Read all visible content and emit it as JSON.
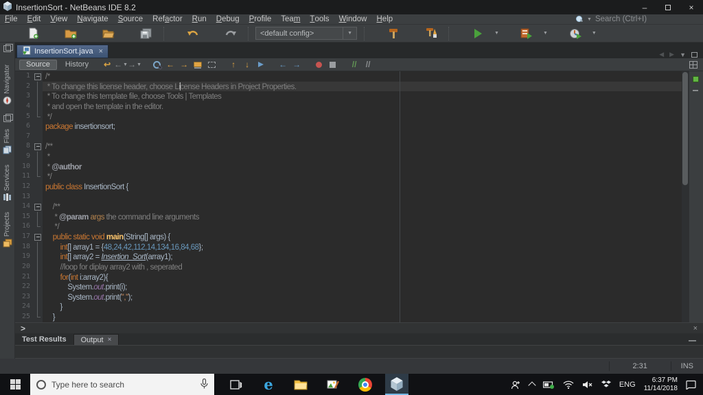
{
  "window": {
    "title": "InsertionSort - NetBeans IDE 8.2"
  },
  "menubar": {
    "items": [
      {
        "label": "File",
        "mn": 0
      },
      {
        "label": "Edit",
        "mn": 0
      },
      {
        "label": "View",
        "mn": 0
      },
      {
        "label": "Navigate",
        "mn": 0
      },
      {
        "label": "Source",
        "mn": 0
      },
      {
        "label": "Refactor",
        "mn": 3
      },
      {
        "label": "Run",
        "mn": 0
      },
      {
        "label": "Debug",
        "mn": 0
      },
      {
        "label": "Profile",
        "mn": 0
      },
      {
        "label": "Team",
        "mn": 3
      },
      {
        "label": "Tools",
        "mn": 0
      },
      {
        "label": "Window",
        "mn": 0
      },
      {
        "label": "Help",
        "mn": 0
      }
    ],
    "search_placeholder": "Search (Ctrl+I)"
  },
  "toolbar": {
    "config_value": "<default config>"
  },
  "sidebar": {
    "items": [
      {
        "label": "Navigator",
        "icon": "compass-icon"
      },
      {
        "label": "Files",
        "icon": "files-icon"
      },
      {
        "label": "Services",
        "icon": "services-icon"
      },
      {
        "label": "Projects",
        "icon": "projects-icon"
      }
    ]
  },
  "editor": {
    "tab_title": "InsertionSort.java",
    "view_source": "Source",
    "view_history": "History",
    "breadcrumb_chevron": ">",
    "close_glyph": "×",
    "minimize_glyph": "—",
    "caret_status": "2:31",
    "toolbar_icons": [
      {
        "name": "last-edit-position-icon",
        "glyph": "↩",
        "color": "#d9a343"
      },
      {
        "name": "back-icon",
        "glyph": "←",
        "color": "#8a8d8f",
        "dd": true
      },
      {
        "name": "forward-icon",
        "glyph": "→",
        "color": "#8a8d8f",
        "dd": true
      },
      {
        "name": "sep"
      },
      {
        "name": "find-selection-icon",
        "shape": "mag"
      },
      {
        "name": "previous-occurrence-icon",
        "glyph": "←",
        "color": "#e0a343"
      },
      {
        "name": "next-occurrence-icon",
        "glyph": "→",
        "color": "#e0a343"
      },
      {
        "name": "toggle-highlight-icon",
        "shape": "block"
      },
      {
        "name": "rectangular-selection-icon",
        "shape": "dashedrect"
      },
      {
        "name": "sep"
      },
      {
        "name": "move-up-icon",
        "glyph": "↑",
        "color": "#e0a343"
      },
      {
        "name": "move-down-icon",
        "glyph": "↓",
        "color": "#e0a343"
      },
      {
        "name": "next-bookmark-icon",
        "shape": "flag"
      },
      {
        "name": "sep"
      },
      {
        "name": "shift-left-icon",
        "glyph": "←",
        "color": "#6a9cc8"
      },
      {
        "name": "shift-right-icon",
        "glyph": "→",
        "color": "#6a9cc8"
      },
      {
        "name": "sep"
      },
      {
        "name": "record-macro-icon",
        "shape": "dot"
      },
      {
        "name": "stop-macro-icon",
        "shape": "square"
      },
      {
        "name": "sep"
      },
      {
        "name": "comment-icon",
        "glyph": "//",
        "color": "#629755"
      },
      {
        "name": "uncomment-icon",
        "glyph": "//",
        "color": "#8a8d8f"
      }
    ],
    "lines": [
      {
        "fold": "start",
        "segs": [
          [
            "/*",
            "sc"
          ]
        ]
      },
      {
        "fold": "mid",
        "hl": true,
        "segs": [
          [
            " * To change this license header, choose License Headers in Project Properties.",
            "sc"
          ]
        ]
      },
      {
        "fold": "mid",
        "segs": [
          [
            " * To change this template file, choose Tools | Templates",
            "sc"
          ]
        ]
      },
      {
        "fold": "mid",
        "segs": [
          [
            " * and open the template in the editor.",
            "sc"
          ]
        ]
      },
      {
        "fold": "end",
        "segs": [
          [
            " */",
            "sc"
          ]
        ]
      },
      {
        "fold": "",
        "segs": [
          [
            "package",
            "sk"
          ],
          [
            " insertionsort;",
            "sd"
          ]
        ]
      },
      {
        "fold": "",
        "segs": []
      },
      {
        "fold": "start",
        "segs": [
          [
            "/**",
            "sc"
          ]
        ]
      },
      {
        "fold": "mid",
        "segs": [
          [
            " *",
            "sc"
          ]
        ]
      },
      {
        "fold": "mid",
        "segs": [
          [
            " * ",
            "sc"
          ],
          [
            "@author",
            "st"
          ]
        ]
      },
      {
        "fold": "end",
        "segs": [
          [
            " */",
            "sc"
          ]
        ]
      },
      {
        "fold": "",
        "segs": [
          [
            "public ",
            "sk"
          ],
          [
            "class ",
            "sk"
          ],
          [
            "InsertionSort {",
            "sd"
          ]
        ]
      },
      {
        "fold": "",
        "segs": []
      },
      {
        "fold": "start",
        "segs": [
          [
            "    /**",
            "sc"
          ]
        ]
      },
      {
        "fold": "mid",
        "segs": [
          [
            "     * ",
            "sc"
          ],
          [
            "@param",
            "st"
          ],
          [
            " ",
            "sc"
          ],
          [
            "args",
            "sp"
          ],
          [
            " the command line arguments",
            "sc"
          ]
        ]
      },
      {
        "fold": "end",
        "segs": [
          [
            "     */",
            "sc"
          ]
        ]
      },
      {
        "fold": "start",
        "segs": [
          [
            "    ",
            "sd"
          ],
          [
            "public static void ",
            "sk"
          ],
          [
            "main",
            "sm"
          ],
          [
            "(String[] args) {",
            "sd"
          ]
        ]
      },
      {
        "fold": "mid",
        "segs": [
          [
            "        ",
            "sd"
          ],
          [
            "int",
            "sk"
          ],
          [
            "[] array1 = {",
            "sd"
          ],
          [
            "48,24,42,112,14,134,16,84,68",
            "sn"
          ],
          [
            "};",
            "sd"
          ]
        ]
      },
      {
        "fold": "mid",
        "segs": [
          [
            "        ",
            "sd"
          ],
          [
            "int",
            "sk"
          ],
          [
            "[] array2 = ",
            "sd"
          ],
          [
            "Insertion_Sort",
            "si"
          ],
          [
            "(array1);",
            "sd"
          ]
        ]
      },
      {
        "fold": "mid",
        "segs": [
          [
            "        ",
            "sd"
          ],
          [
            "//loop for diplay array2 with , seperated",
            "sc"
          ]
        ]
      },
      {
        "fold": "mid",
        "segs": [
          [
            "        ",
            "sd"
          ],
          [
            "for",
            "sk"
          ],
          [
            "(",
            "sd"
          ],
          [
            "int",
            "sk"
          ],
          [
            " i:array2){",
            "sd"
          ]
        ]
      },
      {
        "fold": "mid",
        "segs": [
          [
            "            System.",
            "sd"
          ],
          [
            "out",
            "sf"
          ],
          [
            ".print(i);",
            "sd"
          ]
        ]
      },
      {
        "fold": "mid",
        "segs": [
          [
            "            System.",
            "sd"
          ],
          [
            "out",
            "sf"
          ],
          [
            ".print(",
            "sd"
          ],
          [
            "\",\"",
            "ss"
          ],
          [
            ");",
            "sd"
          ]
        ]
      },
      {
        "fold": "mid",
        "segs": [
          [
            "        }",
            "sd"
          ]
        ]
      },
      {
        "fold": "end",
        "segs": [
          [
            "    }",
            "sd"
          ]
        ]
      }
    ]
  },
  "bottom": {
    "tabs": [
      {
        "label": "Test Results",
        "active": false,
        "closable": false
      },
      {
        "label": "Output",
        "active": true,
        "closable": true
      }
    ]
  },
  "status": {
    "caret": "2:31",
    "mode": "INS"
  },
  "taskbar": {
    "search_placeholder": "Type here to search",
    "language": "ENG",
    "time": "6:37 PM",
    "date": "11/14/2018"
  }
}
